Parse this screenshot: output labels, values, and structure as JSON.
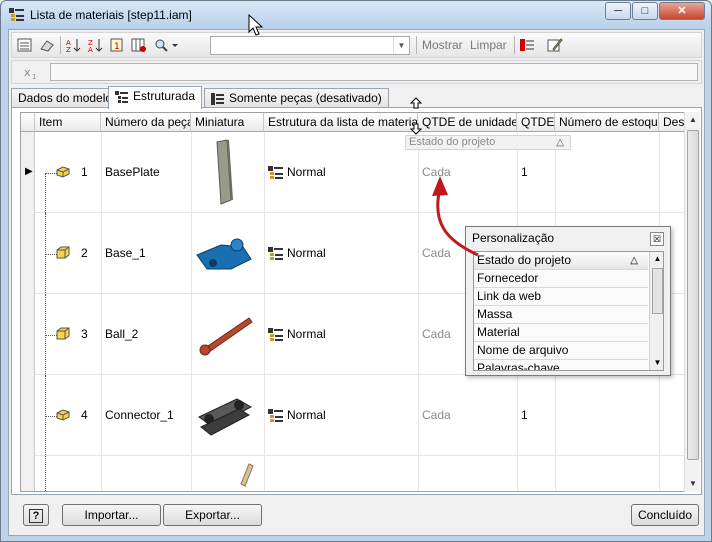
{
  "window": {
    "title": "Lista de materiais [step11.iam]",
    "min_label": "─",
    "max_label": "□",
    "close_label": "✕"
  },
  "toolbar": {
    "mostrar": "Mostrar",
    "limpar": "Limpar",
    "combo_value": ""
  },
  "tabs": [
    {
      "label": "Dados do modelo"
    },
    {
      "label": "Estruturada"
    },
    {
      "label": "Somente peças (desativado)"
    }
  ],
  "grid": {
    "headers": [
      "Item",
      "Número da peça",
      "Miniatura",
      "Estrutura da lista de materiais",
      "QTDE de unidades",
      "QTDE",
      "Número de estoque",
      "Des"
    ],
    "group_label": "Estado do projeto",
    "group_sort": "△",
    "rows": [
      {
        "item": "1",
        "part": "BasePlate",
        "structure": "Normal",
        "unit_qty": "Cada",
        "qty": "1",
        "color": "#9a9a8a"
      },
      {
        "item": "2",
        "part": "Base_1",
        "structure": "Normal",
        "unit_qty": "Cada",
        "qty": "",
        "color": "#1a6fb0"
      },
      {
        "item": "3",
        "part": "Ball_2",
        "structure": "Normal",
        "unit_qty": "Cada",
        "qty": "",
        "color": "#b5482e"
      },
      {
        "item": "4",
        "part": "Connector_1",
        "structure": "Normal",
        "unit_qty": "Cada",
        "qty": "1",
        "color": "#3d3d3d"
      }
    ]
  },
  "popup": {
    "title": "Personalização",
    "close": "☒",
    "items": [
      "Estado do projeto",
      "Fornecedor",
      "Link da web",
      "Massa",
      "Material",
      "Nome de arquivo",
      "Palavras-chave"
    ],
    "first_sort": "△"
  },
  "buttons": {
    "help": "?",
    "import": "Importar...",
    "export": "Exportar...",
    "done": "Concluído"
  },
  "colors": {
    "accent_arrow": "#c0181e",
    "window_frame": "#bcd3ea"
  }
}
